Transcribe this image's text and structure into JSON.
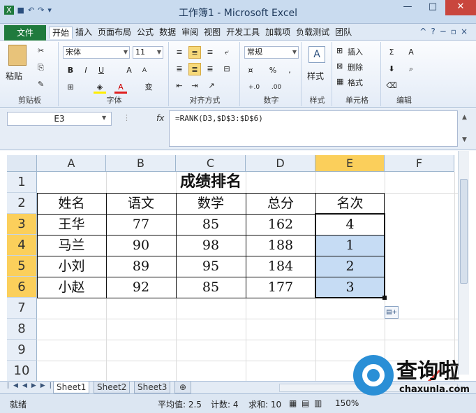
{
  "window": {
    "title": "工作簿1 - Microsoft Excel"
  },
  "quick_access": {
    "icons": [
      "save-icon",
      "undo-icon",
      "redo-icon",
      "customize-icon"
    ]
  },
  "tabs": {
    "file": "文件",
    "items": [
      "开始",
      "插入",
      "页面布局",
      "公式",
      "数据",
      "审阅",
      "视图",
      "开发工具",
      "加载项",
      "负载测试",
      "团队"
    ],
    "active": "开始"
  },
  "ribbon": {
    "clipboard": {
      "paste": "粘贴",
      "label": "剪贴板"
    },
    "font": {
      "name": "宋体",
      "size": "11",
      "bold": "B",
      "italic": "I",
      "underline": "U",
      "grow": "A",
      "shrink": "A",
      "label": "字体",
      "phonetic": "变"
    },
    "alignment": {
      "label": "对齐方式"
    },
    "number": {
      "format": "常规",
      "percent": "%",
      "comma": ",",
      "inc": "+.0",
      "dec": ".00",
      "label": "数字"
    },
    "styles": {
      "label": "样式",
      "button": "样式"
    },
    "cells": {
      "insert": "插入",
      "delete": "删除",
      "format": "格式",
      "label": "单元格"
    },
    "editing": {
      "sum": "Σ",
      "sort": "A",
      "label": "编辑"
    }
  },
  "formula_bar": {
    "name_box": "E3",
    "fx": "fx",
    "formula": "=RANK(D3,$D$3:$D$6)"
  },
  "sheet": {
    "columns": [
      "A",
      "B",
      "C",
      "D",
      "E",
      "F"
    ],
    "selected_column": "E",
    "rows": [
      "1",
      "2",
      "3",
      "4",
      "5",
      "6",
      "7",
      "8",
      "9",
      "10"
    ],
    "selected_rows": [
      "3",
      "4",
      "5",
      "6"
    ],
    "title": "成绩排名",
    "headers": [
      "姓名",
      "语文",
      "数学",
      "总分",
      "名次"
    ],
    "data": [
      [
        "王华",
        "77",
        "85",
        "162",
        "4"
      ],
      [
        "马兰",
        "90",
        "98",
        "188",
        "1"
      ],
      [
        "小刘",
        "89",
        "95",
        "184",
        "2"
      ],
      [
        "小赵",
        "92",
        "85",
        "177",
        "3"
      ]
    ]
  },
  "sheet_tabs": [
    "Sheet1",
    "Sheet2",
    "Sheet3"
  ],
  "active_sheet": "Sheet1",
  "status": {
    "ready": "就绪",
    "average": "平均值: 2.5",
    "count": "计数: 4",
    "sum": "求和: 10",
    "zoom": "150%"
  },
  "watermark": {
    "text": "查询啦",
    "url": "chaxunla.com"
  },
  "colors": {
    "accent": "#1f7a3d",
    "selected_header": "#fbcf5b",
    "selection_fill": "#c6dcf4",
    "arrow": "#e0413b"
  }
}
